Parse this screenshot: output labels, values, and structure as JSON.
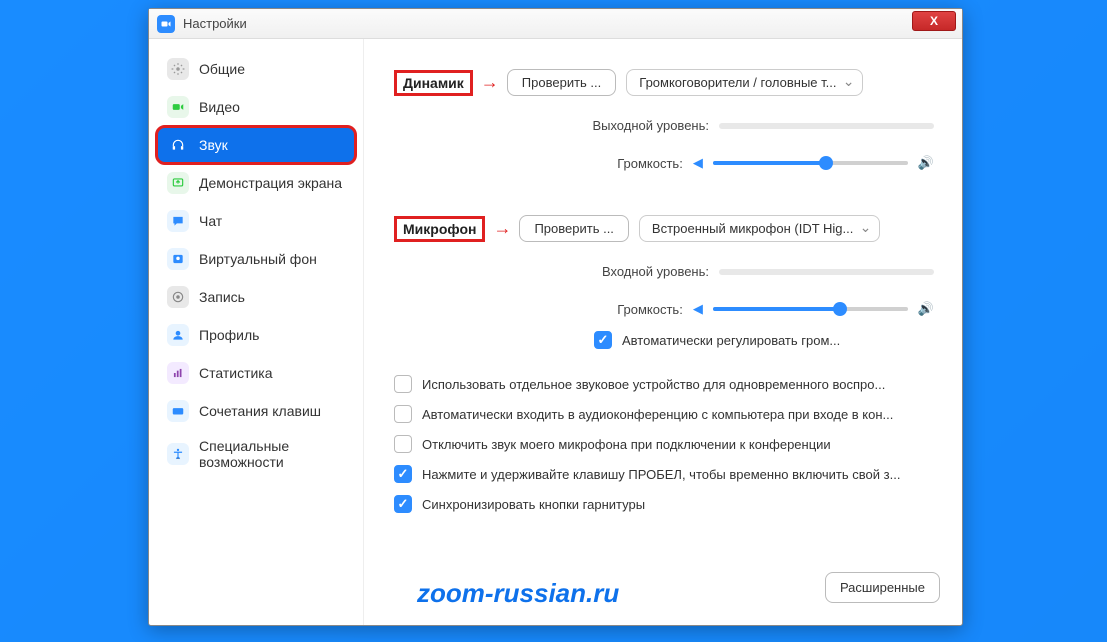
{
  "window": {
    "title": "Настройки",
    "close": "X"
  },
  "sidebar": {
    "items": [
      {
        "label": "Общие",
        "icon": "gear",
        "color": "#e8e8e8",
        "fg": "#999"
      },
      {
        "label": "Видео",
        "icon": "video",
        "color": "#e8f7ea",
        "fg": "#2ecc40"
      },
      {
        "label": "Звук",
        "icon": "headphones",
        "color": "#ffffff",
        "fg": "#ffffff",
        "selected": true
      },
      {
        "label": "Демонстрация экрана",
        "icon": "share",
        "color": "#e8f7ea",
        "fg": "#2ecc40"
      },
      {
        "label": "Чат",
        "icon": "chat",
        "color": "#e8f4ff",
        "fg": "#2d8cff"
      },
      {
        "label": "Виртуальный фон",
        "icon": "bg",
        "color": "#e8f4ff",
        "fg": "#2d8cff"
      },
      {
        "label": "Запись",
        "icon": "record",
        "color": "#e8e8e8",
        "fg": "#888"
      },
      {
        "label": "Профиль",
        "icon": "profile",
        "color": "#e8f4ff",
        "fg": "#2d8cff"
      },
      {
        "label": "Статистика",
        "icon": "stats",
        "color": "#f3eaff",
        "fg": "#8e44ad"
      },
      {
        "label": "Сочетания клавиш",
        "icon": "keyboard",
        "color": "#e8f4ff",
        "fg": "#2d8cff"
      },
      {
        "label": "Специальные возможности",
        "icon": "access",
        "color": "#e8f4ff",
        "fg": "#2d8cff"
      }
    ]
  },
  "speaker": {
    "section_label": "Динамик",
    "test_button": "Проверить ...",
    "device": "Громкоговорители / головные т...",
    "output_level_label": "Выходной уровень:",
    "volume_label": "Громкость:",
    "volume_percent": 58
  },
  "microphone": {
    "section_label": "Микрофон",
    "test_button": "Проверить ...",
    "device": "Встроенный микрофон (IDT Hig...",
    "input_level_label": "Входной уровень:",
    "volume_label": "Громкость:",
    "volume_percent": 65,
    "auto_adjust": {
      "checked": true,
      "label": "Автоматически регулировать гром..."
    }
  },
  "options": [
    {
      "checked": false,
      "label": "Использовать отдельное звуковое устройство для одновременного воспро..."
    },
    {
      "checked": false,
      "label": "Автоматически входить в аудиоконференцию с компьютера при входе в кон..."
    },
    {
      "checked": false,
      "label": "Отключить звук моего микрофона при подключении к конференции"
    },
    {
      "checked": true,
      "label": "Нажмите и удерживайте клавишу ПРОБЕЛ, чтобы временно включить свой з..."
    },
    {
      "checked": true,
      "label": "Синхронизировать кнопки гарнитуры"
    }
  ],
  "advanced_button": "Расширенные",
  "watermark": "zoom-russian.ru"
}
